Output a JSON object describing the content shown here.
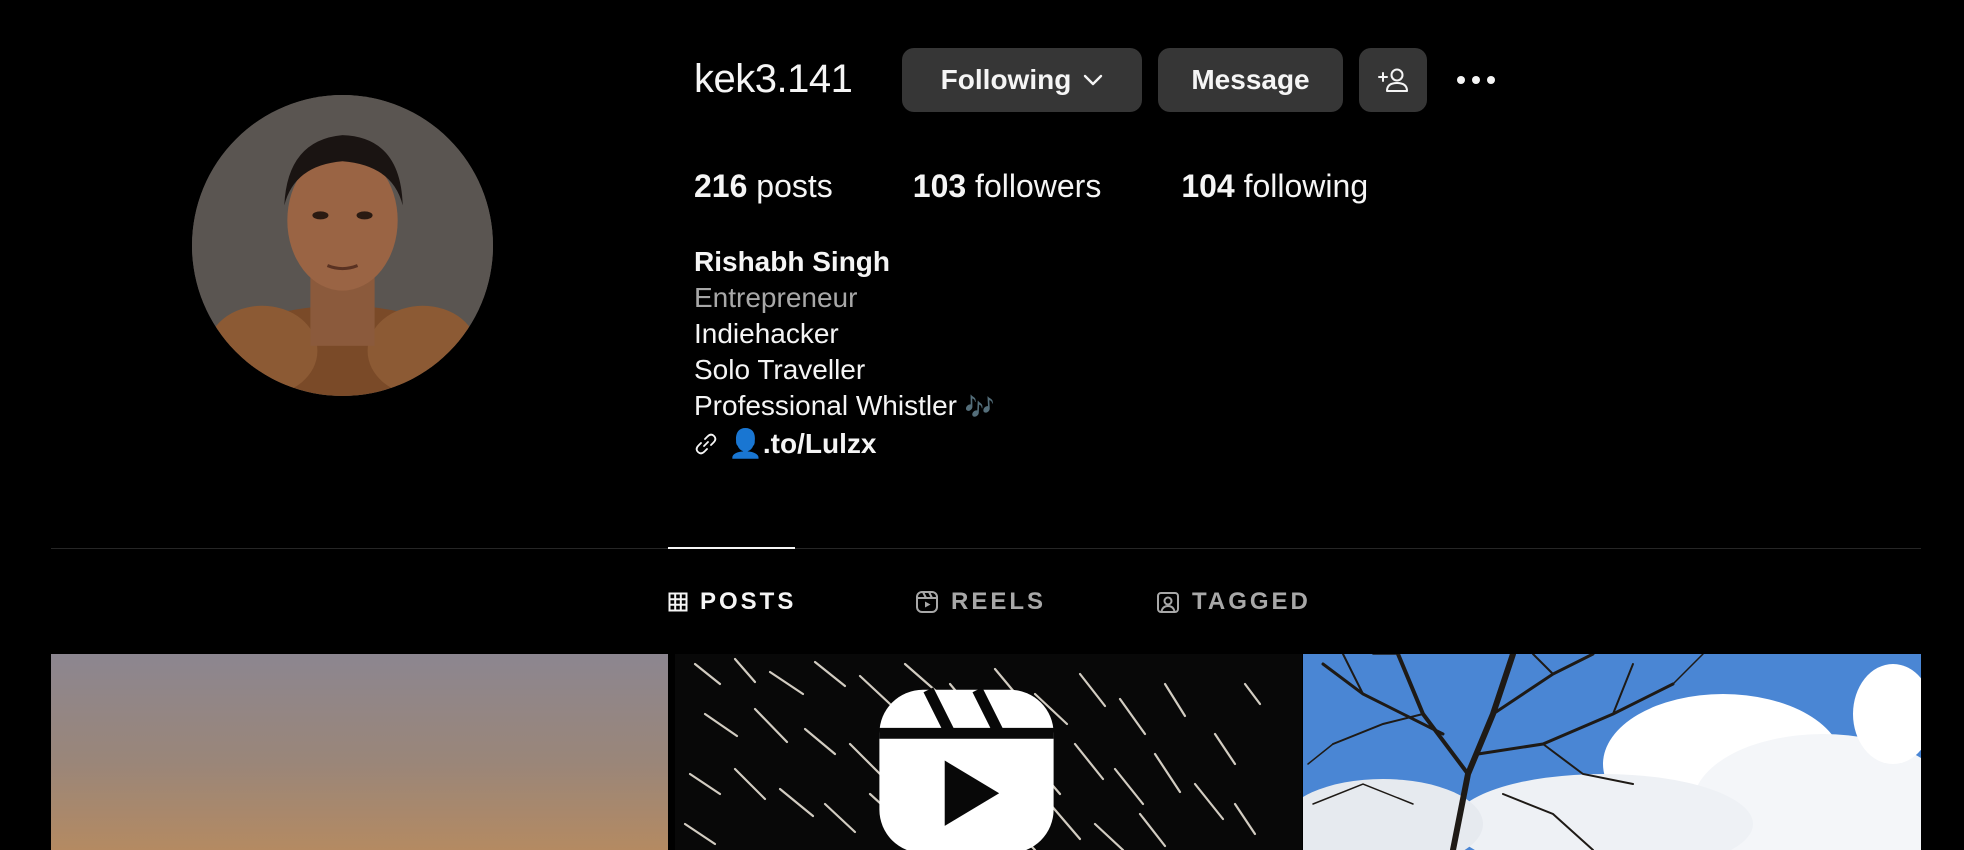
{
  "profile": {
    "username": "kek3.141",
    "avatar_icon": "profile-photo"
  },
  "actions": {
    "following_label": "Following",
    "message_label": "Message",
    "add_user_icon": "add-user-icon",
    "more_icon": "more-horizontal-icon"
  },
  "stats": {
    "posts_count": "216",
    "posts_label": "posts",
    "followers_count": "103",
    "followers_label": "followers",
    "following_count": "104",
    "following_label": "following"
  },
  "bio": {
    "name": "Rishabh Singh",
    "category": "Entrepreneur",
    "lines": [
      "Indiehacker",
      "Solo Traveller",
      "Professional Whistler"
    ],
    "whistler_emoji": "🎶",
    "link_emoji": "👤",
    "link_text": ".to/Lulzx"
  },
  "tabs": [
    {
      "label": "POSTS",
      "icon": "grid-icon",
      "active": true
    },
    {
      "label": "REELS",
      "icon": "reels-icon",
      "active": false
    },
    {
      "label": "TAGGED",
      "icon": "tagged-icon",
      "active": false
    }
  ],
  "colors": {
    "background": "#000000",
    "button": "#363636",
    "text": "#f5f5f5",
    "muted": "#a8a8a8"
  }
}
